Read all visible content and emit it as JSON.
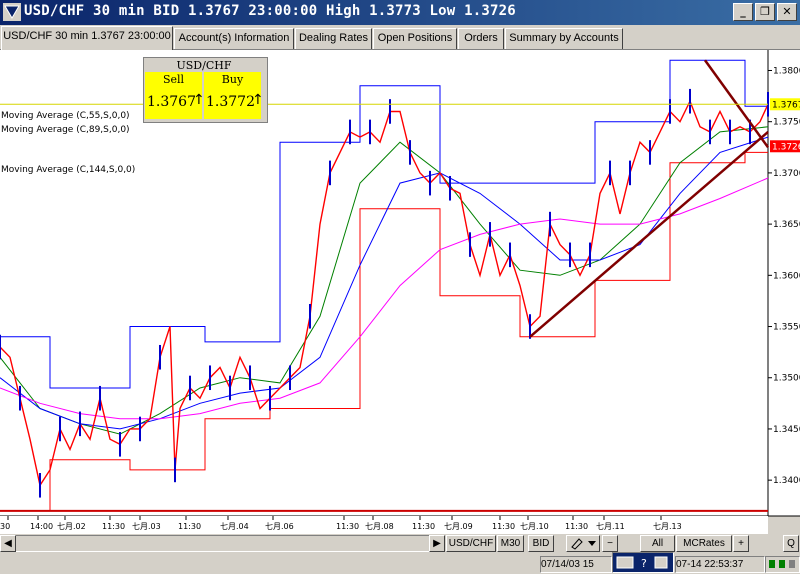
{
  "window": {
    "title": "USD/CHF 30 min BID 1.3767 23:00:00 High 1.3773 Low 1.3726",
    "buttons": {
      "minimize": "_",
      "maximize": "❐",
      "close": "✕"
    }
  },
  "tabs": [
    {
      "label": "USD/CHF 30 min 1.3767 23:00:00",
      "active": true
    },
    {
      "label": "Account(s) Information"
    },
    {
      "label": "Dealing Rates"
    },
    {
      "label": "Open Positions"
    },
    {
      "label": "Orders"
    },
    {
      "label": "Summary by Accounts"
    }
  ],
  "quote": {
    "symbol": "USD/CHF",
    "sell_label": "Sell",
    "sell_value": "1.3767",
    "buy_label": "Buy",
    "buy_value": "1.3772",
    "sell_arrow": "↑",
    "buy_arrow": "↑",
    "highlight_color": "#ffff00"
  },
  "indicators": [
    {
      "label": "Moving Average (C,55,S,0,0)",
      "color": "#008000"
    },
    {
      "label": "Moving Average (C,89,S,0,0)",
      "color": "#0000ff"
    },
    {
      "label": "Moving Average (C,144,S,0,0)",
      "color": "#ff00ff"
    }
  ],
  "price_axis": {
    "ticks": [
      "1.3800",
      "1.3750",
      "1.3700",
      "1.3650",
      "1.3600",
      "1.3550",
      "1.3500",
      "1.3450",
      "1.3400"
    ],
    "current_bid": "1.3767",
    "current_low": "1.3726",
    "bid_color": "#ffff00",
    "low_color": "#ff0000"
  },
  "time_axis": {
    "labels": [
      "30",
      "14:00",
      "七月.02",
      "11:30",
      "七月.03",
      "11:30",
      "七月.04",
      "七月.06",
      "11:30",
      "七月.08",
      "11:30",
      "七月.09",
      "11:30",
      "七月.10",
      "11:30",
      "七月.11",
      "七月.13"
    ]
  },
  "chart_data": {
    "type": "line",
    "symbol": "USD/CHF",
    "timeframe": "30 min",
    "ylim": [
      1.3365,
      1.382
    ],
    "series": [
      {
        "name": "USD/CHF",
        "color": "#ff0000",
        "x": [
          0,
          10,
          20,
          30,
          40,
          50,
          60,
          70,
          80,
          90,
          100,
          110,
          120,
          130,
          140,
          150,
          160,
          170,
          175,
          180,
          190,
          200,
          210,
          220,
          230,
          240,
          250,
          260,
          270,
          280,
          290,
          300,
          310,
          320,
          330,
          340,
          350,
          360,
          370,
          380,
          390,
          400,
          410,
          420,
          430,
          440,
          450,
          460,
          470,
          480,
          490,
          500,
          510,
          520,
          530,
          540,
          550,
          560,
          570,
          580,
          590,
          600,
          610,
          620,
          630,
          640,
          650,
          660,
          670,
          680,
          690,
          700,
          710,
          720,
          730,
          740,
          750,
          760,
          768
        ],
        "y": [
          1.353,
          1.352,
          1.348,
          1.344,
          1.3395,
          1.341,
          1.345,
          1.343,
          1.3455,
          1.344,
          1.348,
          1.344,
          1.3435,
          1.345,
          1.345,
          1.346,
          1.352,
          1.355,
          1.341,
          1.347,
          1.349,
          1.348,
          1.35,
          1.351,
          1.349,
          1.352,
          1.35,
          1.347,
          1.348,
          1.349,
          1.35,
          1.351,
          1.356,
          1.365,
          1.37,
          1.372,
          1.374,
          1.3735,
          1.374,
          1.373,
          1.376,
          1.376,
          1.372,
          1.37,
          1.369,
          1.37,
          1.3685,
          1.368,
          1.363,
          1.36,
          1.364,
          1.36,
          1.362,
          1.359,
          1.355,
          1.356,
          1.365,
          1.363,
          1.362,
          1.36,
          1.362,
          1.368,
          1.37,
          1.366,
          1.37,
          1.373,
          1.372,
          1.374,
          1.376,
          1.375,
          1.377,
          1.3745,
          1.374,
          1.376,
          1.374,
          1.3745,
          1.374,
          1.375,
          1.3767
        ]
      },
      {
        "name": "MA55",
        "color": "#008000",
        "x": [
          0,
          40,
          80,
          120,
          160,
          200,
          240,
          280,
          320,
          360,
          400,
          440,
          480,
          520,
          560,
          600,
          640,
          680,
          720,
          768
        ],
        "y": [
          1.352,
          1.347,
          1.3455,
          1.3445,
          1.3465,
          1.349,
          1.35,
          1.3495,
          1.356,
          1.369,
          1.373,
          1.37,
          1.365,
          1.3605,
          1.36,
          1.3615,
          1.365,
          1.371,
          1.374,
          1.3745
        ]
      },
      {
        "name": "MA89",
        "color": "#0000ff",
        "x": [
          0,
          40,
          80,
          120,
          160,
          200,
          240,
          280,
          320,
          360,
          400,
          440,
          480,
          520,
          560,
          600,
          640,
          680,
          720,
          768
        ],
        "y": [
          1.35,
          1.347,
          1.3455,
          1.345,
          1.346,
          1.3475,
          1.3485,
          1.349,
          1.352,
          1.361,
          1.369,
          1.37,
          1.368,
          1.365,
          1.3615,
          1.3615,
          1.363,
          1.368,
          1.372,
          1.3735
        ]
      },
      {
        "name": "MA144",
        "color": "#ff00ff",
        "x": [
          0,
          40,
          80,
          120,
          160,
          200,
          240,
          280,
          320,
          360,
          400,
          440,
          480,
          520,
          560,
          600,
          640,
          680,
          720,
          768
        ],
        "y": [
          1.349,
          1.3475,
          1.3465,
          1.346,
          1.346,
          1.3465,
          1.3475,
          1.348,
          1.3495,
          1.354,
          1.359,
          1.3625,
          1.364,
          1.365,
          1.3655,
          1.365,
          1.365,
          1.366,
          1.3675,
          1.3695
        ]
      },
      {
        "name": "red step",
        "color": "#ff0000",
        "x": [
          0,
          50,
          50,
          130,
          130,
          205,
          205,
          270,
          270,
          285,
          285,
          360,
          360,
          440,
          440,
          520,
          520,
          595,
          595,
          670,
          670,
          745,
          745,
          768
        ],
        "y": [
          1.337,
          1.337,
          1.342,
          1.342,
          1.341,
          1.341,
          1.346,
          1.346,
          1.347,
          1.347,
          1.347,
          1.347,
          1.3665,
          1.3665,
          1.358,
          1.358,
          1.354,
          1.354,
          1.3595,
          1.3595,
          1.371,
          1.371,
          1.372,
          1.372
        ]
      },
      {
        "name": "blue step",
        "color": "#0000ff",
        "x": [
          0,
          50,
          50,
          130,
          130,
          205,
          205,
          280,
          280,
          360,
          360,
          440,
          440,
          520,
          520,
          595,
          595,
          670,
          670,
          745,
          745,
          768
        ],
        "y": [
          1.354,
          1.354,
          1.349,
          1.349,
          1.355,
          1.355,
          1.3535,
          1.3535,
          1.373,
          1.373,
          1.3785,
          1.3785,
          1.369,
          1.369,
          1.369,
          1.369,
          1.375,
          1.375,
          1.381,
          1.381,
          1.3765,
          1.3765
        ]
      }
    ],
    "trendlines": [
      {
        "color": "#800000",
        "x": [
          530,
          768
        ],
        "y": [
          1.354,
          1.374
        ]
      },
      {
        "color": "#800000",
        "x": [
          705,
          768
        ],
        "y": [
          1.381,
          1.3725
        ]
      }
    ],
    "grid": false
  },
  "statusbar": {
    "symbol_btn": "USD/CHF",
    "period_btn": "M30",
    "mode_btn": "BID",
    "all_btn": "All",
    "rates_btn": "MCRates",
    "q_btn": "Q",
    "left_date": "07/14/03 15",
    "right_datetime": "07-14 22:53:37"
  }
}
